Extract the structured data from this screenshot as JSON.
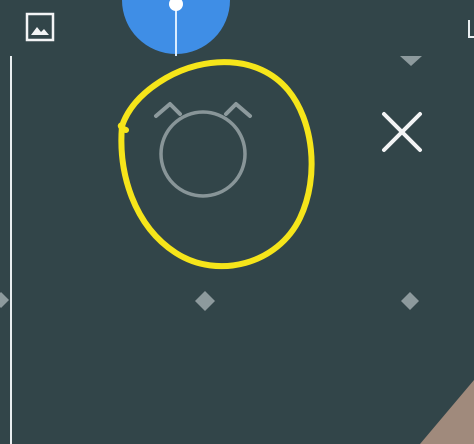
{
  "theme": {
    "background": "#324549",
    "accent_blue": "#3f8ee6",
    "accent_blue_light": "#6fb2ff",
    "highlight_yellow": "#f6e51a",
    "icon_light": "#f3f4f5",
    "icon_muted": "#8d9a9d",
    "image_corner": "#a08a7c"
  },
  "icons": {
    "image": "image-icon",
    "dial_knob": "dial-knob",
    "marker_top": "triangle-down-marker",
    "close": "close-icon",
    "alarm": "alarm-clock-icon",
    "diamond_left": "diamond-marker",
    "diamond_center": "diamond-marker",
    "diamond_right": "diamond-marker"
  }
}
